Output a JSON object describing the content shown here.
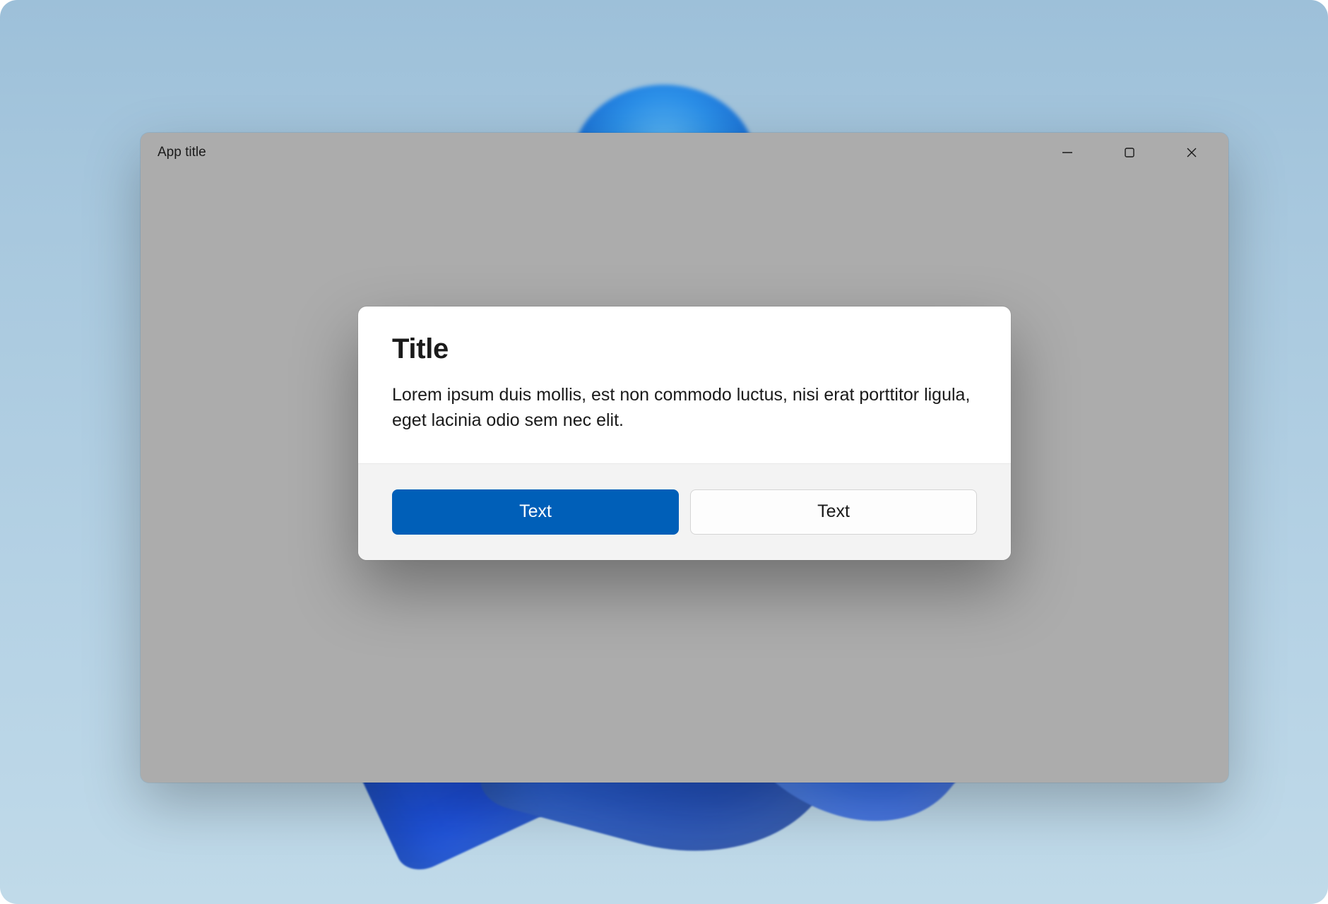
{
  "window": {
    "app_title": "App title"
  },
  "dialog": {
    "title": "Title",
    "body": "Lorem ipsum duis mollis, est non commodo luctus, nisi erat porttitor ligula, eget lacinia odio sem nec elit.",
    "primary_button_label": "Text",
    "secondary_button_label": "Text"
  },
  "colors": {
    "accent": "#005fb8",
    "window_bg": "#acacac",
    "dialog_bg": "#ffffff",
    "dialog_footer_bg": "#f3f3f3"
  }
}
